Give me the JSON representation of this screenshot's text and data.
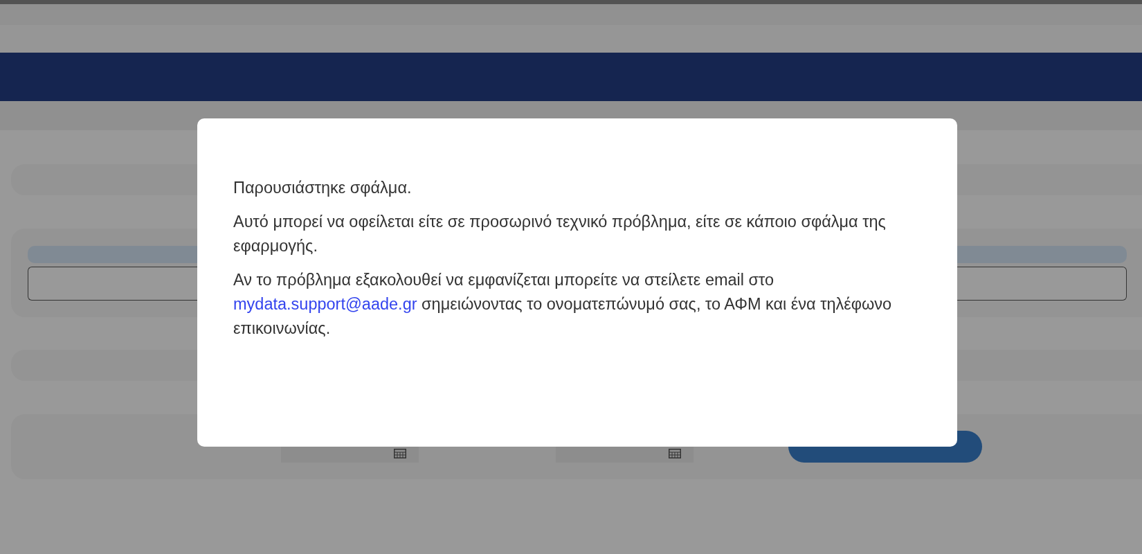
{
  "dialog": {
    "paragraphs": [
      {
        "text": "Παρουσιάστηκε σφάλμα."
      },
      {
        "text": "Αυτό μπορεί να οφείλεται είτε σε προσωρινό τεχνικό πρόβλημα, είτε σε κάποιο σφάλμα της εφαρμογής."
      },
      {
        "text": "Αν το πρόβλημα εξακολουθεί να εμφανίζεται μπορείτε να στείλετε email στο",
        "link": "mydata.support@aade.gr",
        "after": "σημειώνοντας το ονοματεπώνυμό σας, το ΑΦΜ και ένα τηλέφωνο επικοινωνίας."
      }
    ]
  }
}
